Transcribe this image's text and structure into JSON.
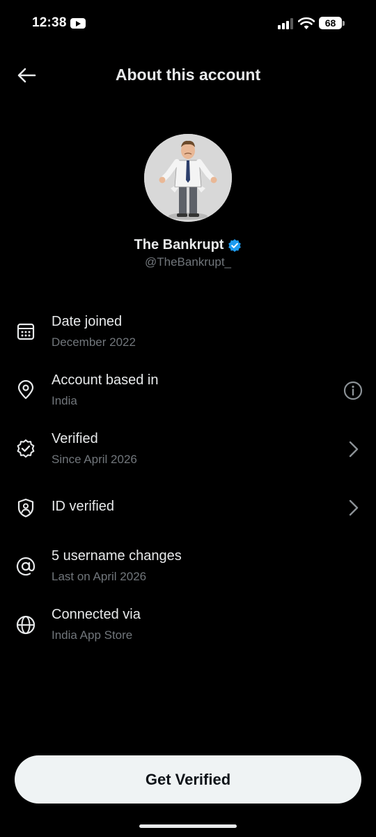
{
  "status_bar": {
    "time": "12:38",
    "battery": "68"
  },
  "header": {
    "title": "About this account"
  },
  "profile": {
    "display_name": "The Bankrupt",
    "handle": "@TheBankrupt_"
  },
  "items": [
    {
      "title": "Date joined",
      "subtitle": "December 2022",
      "icon": "calendar-icon"
    },
    {
      "title": "Account based in",
      "subtitle": "India",
      "icon": "location-pin-icon",
      "trailing": "info-icon"
    },
    {
      "title": "Verified",
      "subtitle": "Since April 2026",
      "icon": "verified-badge-icon",
      "trailing": "chevron-right-icon"
    },
    {
      "title": "ID verified",
      "subtitle": "",
      "icon": "id-shield-icon",
      "trailing": "chevron-right-icon"
    },
    {
      "title": "5 username changes",
      "subtitle": "Last on April 2026",
      "icon": "at-sign-icon"
    },
    {
      "title": "Connected via",
      "subtitle": "India App Store",
      "icon": "globe-icon"
    }
  ],
  "cta": {
    "label": "Get Verified"
  },
  "colors": {
    "background": "#000000",
    "primary_text": "#e7e9ea",
    "secondary_text": "#71767b",
    "verified_blue": "#1d9bf0",
    "button_bg": "#eff3f4"
  }
}
